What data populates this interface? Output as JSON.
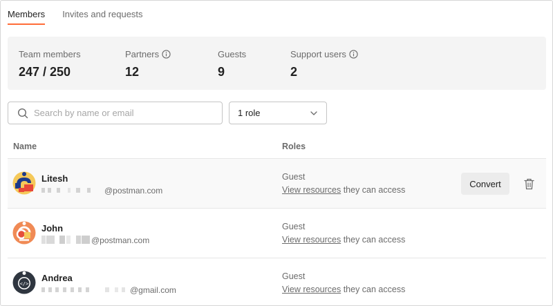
{
  "tabs": [
    {
      "label": "Members",
      "active": true
    },
    {
      "label": "Invites and requests",
      "active": false
    }
  ],
  "stats": [
    {
      "label": "Team members",
      "value": "247 / 250",
      "info": false
    },
    {
      "label": "Partners",
      "value": "12",
      "info": true
    },
    {
      "label": "Guests",
      "value": "9",
      "info": false
    },
    {
      "label": "Support users",
      "value": "2",
      "info": true
    }
  ],
  "search": {
    "placeholder": "Search by name or email",
    "value": ""
  },
  "role_filter": {
    "value": "1 role"
  },
  "table": {
    "columns": {
      "name": "Name",
      "roles": "Roles"
    },
    "rows": [
      {
        "name": "Litesh",
        "email_domain": "@postman.com",
        "role": "Guest",
        "link_text": "View resources",
        "suffix": " they can access",
        "action": "Convert"
      },
      {
        "name": "John",
        "email_domain": "@postman.com",
        "role": "Guest",
        "link_text": "View resources",
        "suffix": " they can access"
      },
      {
        "name": "Andrea",
        "email_domain": "@gmail.com",
        "role": "Guest",
        "link_text": "View resources",
        "suffix": " they can access"
      }
    ]
  },
  "colors": {
    "accent": "#ff6c37",
    "muted_text": "#6b6b6b",
    "stats_bg": "#f4f4f4"
  }
}
